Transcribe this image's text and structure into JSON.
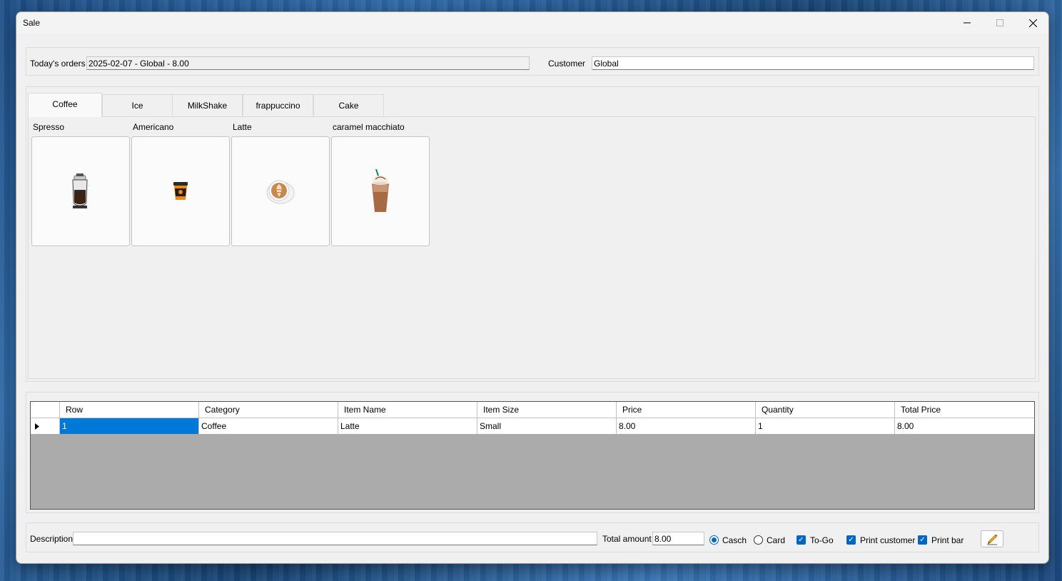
{
  "window": {
    "title": "Sale"
  },
  "header": {
    "todays_orders_label": "Today's orders",
    "todays_orders_value": "2025-02-07 - Global - 8.00",
    "customer_label": "Customer",
    "customer_value": "Global"
  },
  "tabs": [
    {
      "label": "Coffee",
      "active": true
    },
    {
      "label": "Ice"
    },
    {
      "label": "MilkShake"
    },
    {
      "label": "frappuccino"
    },
    {
      "label": "Cake"
    }
  ],
  "products": [
    {
      "name": "Spresso",
      "icon": "espresso-glass-icon"
    },
    {
      "name": "Americano",
      "icon": "takeaway-cup-icon"
    },
    {
      "name": "Latte",
      "icon": "latte-art-cup-icon"
    },
    {
      "name": "caramel macchiato",
      "icon": "iced-drink-icon"
    }
  ],
  "grid": {
    "columns": [
      "Row",
      "Category",
      "Item Name",
      "Item Size",
      "Price",
      "Quantity",
      "Total Price"
    ],
    "rows": [
      [
        "1",
        "Coffee",
        "Latte",
        "Small",
        "8.00",
        "1",
        "8.00"
      ]
    ]
  },
  "footer": {
    "description_label": "Description",
    "description_value": "",
    "total_amount_label": "Total amount",
    "total_amount_value": "8.00",
    "payment_cash_label": "Casch",
    "payment_card_label": "Card",
    "payment_selected": "Casch",
    "to_go_label": "To-Go",
    "print_customer_label": "Print customer",
    "print_bar_label": "Print bar",
    "to_go_checked": true,
    "print_customer_checked": true,
    "print_bar_checked": true
  },
  "colors": {
    "selection": "#0078d7",
    "accent": "#0067c0",
    "grid_empty": "#ababab"
  }
}
